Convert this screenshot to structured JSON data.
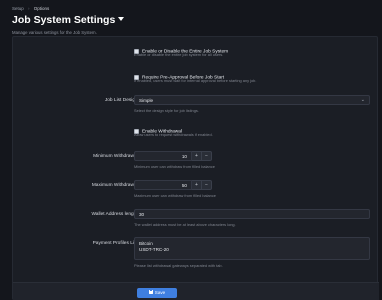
{
  "breadcrumb": {
    "items": [
      "Setup",
      "Options"
    ],
    "separator": "›"
  },
  "header": {
    "title": "Job System Settings",
    "subtitle": "Manage various settings for the Job System."
  },
  "settings": {
    "enable_system": {
      "label": "Enable or Disable the Entire Job System",
      "hint": "Enable or disable the entire job system for all users.",
      "checked": true
    },
    "require_approval": {
      "label": "Require Pre-Approval Before Job Start",
      "hint": "If enabled, users must wait for internal approval before starting any job.",
      "checked": true
    },
    "list_design": {
      "label": "Job List Design:",
      "value": "Simple",
      "hint": "Select the design style for job listings."
    },
    "enable_withdrawal": {
      "label": "Enable Withdrawal",
      "hint": "Allow users to request withdrawals if enabled.",
      "checked": true
    },
    "min_withdrawal": {
      "label": "Minimum Withdrawal:",
      "value": "10",
      "hint": "Minimum user can withdraw from filled balance"
    },
    "max_withdrawal": {
      "label": "Maximum Withdrawal:",
      "value": "50",
      "hint": "Maximum user can withdraw from filled balance"
    },
    "wallet_length": {
      "label": "Wallet Address lenght:",
      "value": "30",
      "hint": "The wallet address must be at least above characters long."
    },
    "payment_profiles": {
      "label": "Payment Profiles List:",
      "lines": [
        "Bitcoin",
        "USDT-TRC-20"
      ],
      "hint": "Please list withdrawal gateways separated with tab."
    }
  },
  "stepper": {
    "plus": "+",
    "minus": "−"
  },
  "footer": {
    "save_label": "Save"
  },
  "colors": {
    "accent": "#3f7fe0",
    "background": "#14161c",
    "panel": "#1b1e25"
  },
  "icons": {
    "dropdown": "caret-down-icon",
    "select_arrow": "chevron-down-icon",
    "save": "floppy-disk-icon"
  }
}
